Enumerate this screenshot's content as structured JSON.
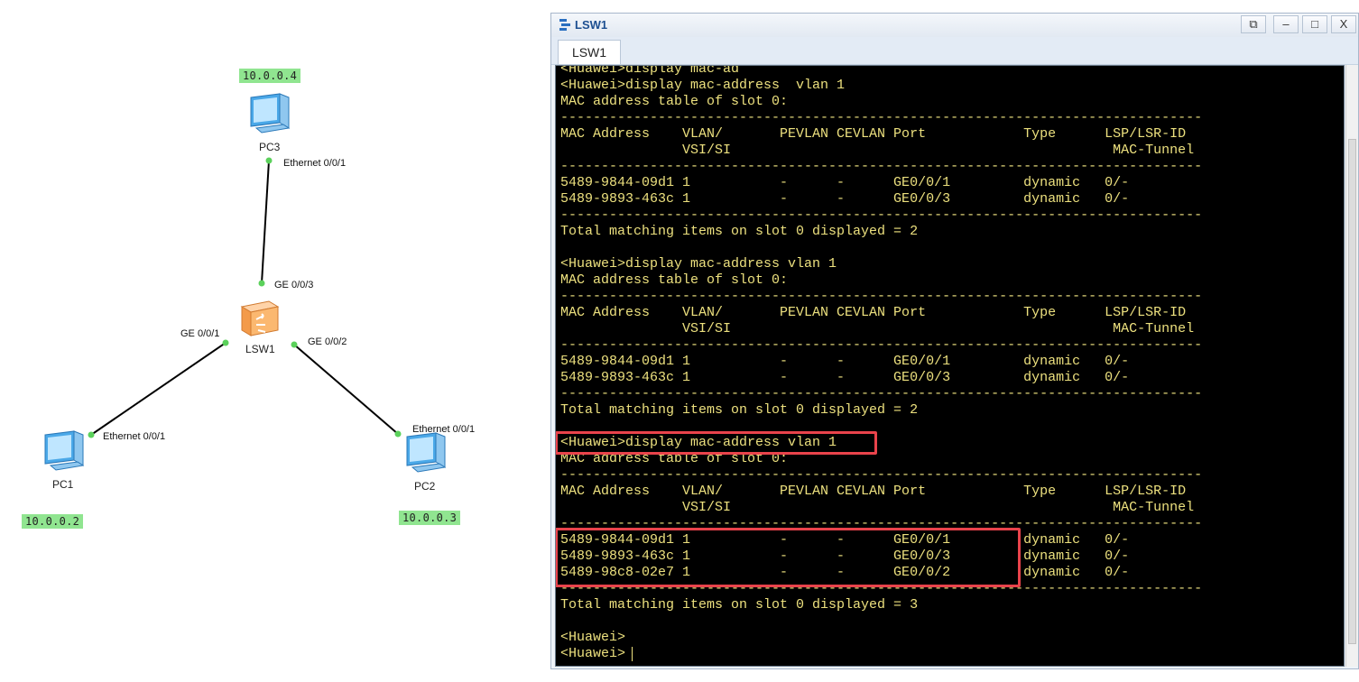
{
  "topology": {
    "devices": [
      {
        "name": "PC3",
        "ip": "10.0.0.4",
        "port": "Ethernet 0/0/1"
      },
      {
        "name": "PC1",
        "ip": "10.0.0.2",
        "port": "Ethernet 0/0/1"
      },
      {
        "name": "PC2",
        "ip": "10.0.0.3",
        "port": "Ethernet 0/0/1"
      }
    ],
    "switch": {
      "name": "LSW1",
      "ports": [
        "GE 0/0/3",
        "GE 0/0/1",
        "GE 0/0/2"
      ]
    }
  },
  "console": {
    "title": "LSW1",
    "tab_label": "LSW1",
    "window_buttons": {
      "restore": "⧉",
      "minimize": "–",
      "maximize": "□",
      "close": "X"
    },
    "lines": [
      "<Huawei>display mac-ad",
      "<Huawei>display mac-address  vlan 1",
      "MAC address table of slot 0:",
      "-------------------------------------------------------------------------------",
      "MAC Address    VLAN/       PEVLAN CEVLAN Port            Type      LSP/LSR-ID",
      "               VSI/SI                                               MAC-Tunnel",
      "-------------------------------------------------------------------------------",
      "5489-9844-09d1 1           -      -      GE0/0/1         dynamic   0/-",
      "5489-9893-463c 1           -      -      GE0/0/3         dynamic   0/-",
      "-------------------------------------------------------------------------------",
      "Total matching items on slot 0 displayed = 2",
      "",
      "<Huawei>display mac-address vlan 1",
      "MAC address table of slot 0:",
      "-------------------------------------------------------------------------------",
      "MAC Address    VLAN/       PEVLAN CEVLAN Port            Type      LSP/LSR-ID",
      "               VSI/SI                                               MAC-Tunnel",
      "-------------------------------------------------------------------------------",
      "5489-9844-09d1 1           -      -      GE0/0/1         dynamic   0/-",
      "5489-9893-463c 1           -      -      GE0/0/3         dynamic   0/-",
      "-------------------------------------------------------------------------------",
      "Total matching items on slot 0 displayed = 2",
      "",
      "<Huawei>display mac-address vlan 1",
      "MAC address table of slot 0:",
      "-------------------------------------------------------------------------------",
      "MAC Address    VLAN/       PEVLAN CEVLAN Port            Type      LSP/LSR-ID",
      "               VSI/SI                                               MAC-Tunnel",
      "-------------------------------------------------------------------------------",
      "5489-9844-09d1 1           -      -      GE0/0/1         dynamic   0/-",
      "5489-9893-463c 1           -      -      GE0/0/3         dynamic   0/-",
      "5489-98c8-02e7 1           -      -      GE0/0/2         dynamic   0/-",
      "-------------------------------------------------------------------------------",
      "Total matching items on slot 0 displayed = 3",
      "",
      "<Huawei>",
      "<Huawei>"
    ]
  },
  "colors": {
    "terminal_bg": "#000000",
    "terminal_text": "#ece07e",
    "highlight": "#e9434b",
    "ip_label_bg": "#90e590",
    "link_dot": "#5bd15b"
  }
}
